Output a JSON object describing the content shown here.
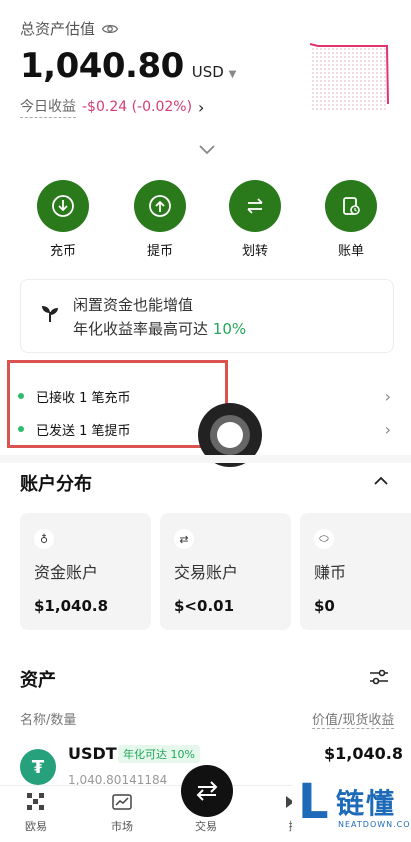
{
  "header": {
    "total_label": "总资产估值",
    "amount": "1,040.80",
    "currency": "USD",
    "today_label": "今日收益",
    "today_pnl": "-$0.24 (-0.02%)"
  },
  "actions": [
    {
      "label": "充币",
      "icon": "deposit-icon"
    },
    {
      "label": "提币",
      "icon": "withdraw-icon"
    },
    {
      "label": "划转",
      "icon": "transfer-icon"
    },
    {
      "label": "账单",
      "icon": "bill-icon"
    }
  ],
  "promo": {
    "line1": "闲置资金也能增值",
    "line2": "年化收益率最高可达",
    "rate": "10%"
  },
  "notifications": [
    {
      "text": "已接收 1 笔充币"
    },
    {
      "text": "已发送 1 笔提币"
    }
  ],
  "accounts": {
    "title": "账户分布",
    "items": [
      {
        "name": "资金账户",
        "value": "$1,040.8"
      },
      {
        "name": "交易账户",
        "value": "$<0.01"
      },
      {
        "name": "赚币",
        "value": "$0"
      }
    ]
  },
  "assets": {
    "title": "资产",
    "col_left": "名称/数量",
    "col_right": "价值/现货收益",
    "rows": [
      {
        "symbol": "USDT",
        "tag": "年化可达 10%",
        "value": "$1,040.8",
        "qty": "1,040.80141184"
      }
    ]
  },
  "bottom_nav": [
    {
      "label": "欧易",
      "icon": "okx-logo-icon"
    },
    {
      "label": "市场",
      "icon": "market-icon"
    },
    {
      "label": "交易",
      "icon": "trade-icon"
    },
    {
      "label": "探",
      "icon": "explore-icon"
    }
  ],
  "watermark": {
    "text": "链懂",
    "url": "NEATDOWN.COM"
  },
  "colors": {
    "accent_green": "#2a7a1c",
    "loss": "#d43c73",
    "gain": "#22a85a",
    "highlight_box": "#d9534f"
  }
}
